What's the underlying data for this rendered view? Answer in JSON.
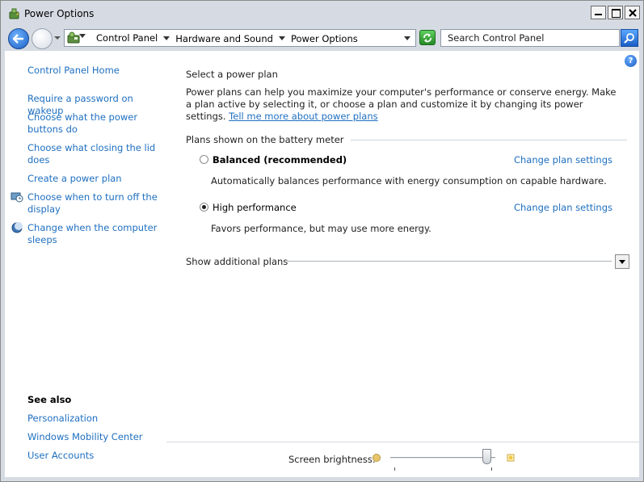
{
  "window": {
    "title": "Power Options"
  },
  "address": {
    "crumbs": [
      "Control Panel",
      "Hardware and Sound",
      "Power Options"
    ],
    "search_placeholder": "Search Control Panel"
  },
  "help_glyph": "?",
  "left_pane": {
    "home": "Control Panel Home",
    "tasks": [
      "Require a password on wakeup",
      "Choose what the power buttons do",
      "Choose what closing the lid does",
      "Create a power plan",
      "Choose when to turn off the display",
      "Change when the computer sleeps"
    ],
    "see_also_heading": "See also",
    "see_also": [
      "Personalization",
      "Windows Mobility Center",
      "User Accounts"
    ]
  },
  "main": {
    "heading": "Select a power plan",
    "description": "Power plans can help you maximize your computer's performance or conserve energy. Make a plan active by selecting it, or choose a plan and customize it by changing its power settings.",
    "tell_me_more": "Tell me more about power plans",
    "group_label": "Plans shown on the battery meter",
    "plans": [
      {
        "name": "Balanced (recommended)",
        "selected": false,
        "link": "Change plan settings",
        "description": "Automatically balances performance with energy consumption on capable hardware."
      },
      {
        "name": "High performance",
        "selected": true,
        "link": "Change plan settings",
        "description": "Favors performance, but may use more energy."
      }
    ],
    "additional_plans": "Show additional plans"
  },
  "brightness": {
    "label": "Screen brightness:",
    "level": 0.95
  },
  "colors": {
    "link": "#1e6fc0",
    "chrome": "#d6dbe3"
  }
}
